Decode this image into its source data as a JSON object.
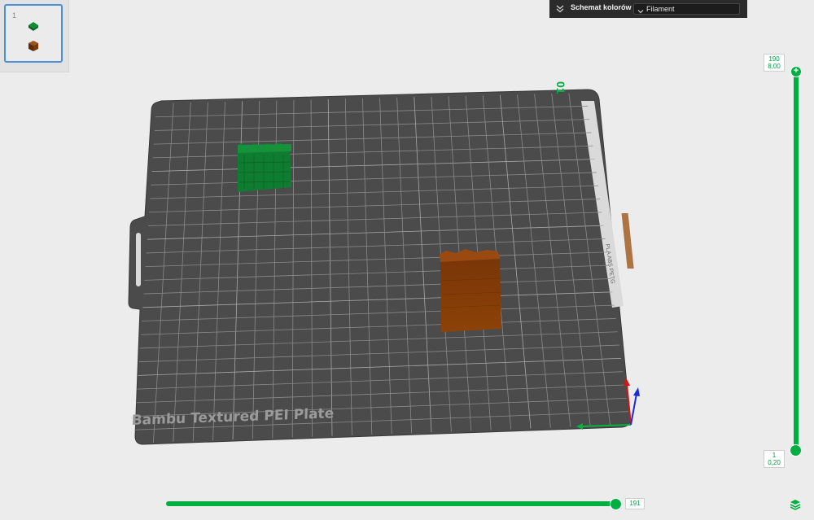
{
  "plate_panel": {
    "plate_number": "1"
  },
  "color_scheme": {
    "label": "Schemat kolorów",
    "selected_value": "Filament"
  },
  "plate": {
    "name": "Bambu Textured PEI Plate",
    "index_label": "01",
    "side_text": "PLA ABS PETG"
  },
  "objects": [
    {
      "name": "green-object",
      "color": "#0e7a30"
    },
    {
      "name": "brown-object",
      "color": "#8a3e05"
    }
  ],
  "layer_slider": {
    "top_layer": "190",
    "top_height": "8,00",
    "bottom_layer": "1",
    "bottom_height": "0,20"
  },
  "move_slider": {
    "value": "191"
  },
  "colors": {
    "accent": "#00ae42",
    "plate": "#4a4a4a",
    "grid": "#8c8c8c"
  },
  "icons": {
    "collapse": "double-chevron-down-icon",
    "dropdown": "chevron-down-icon",
    "layers": "layers-icon"
  }
}
